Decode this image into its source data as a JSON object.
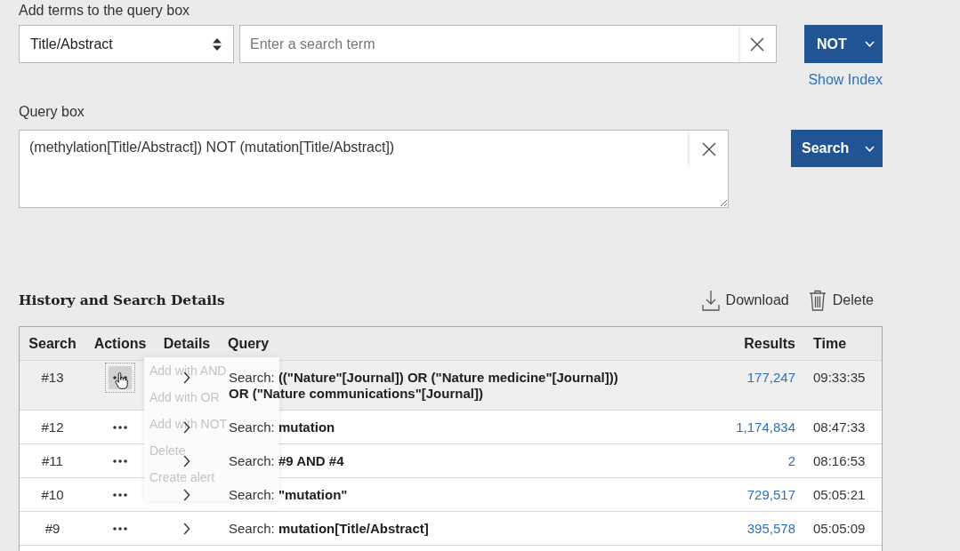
{
  "query_builder": {
    "label": "Add terms to the query box",
    "field": {
      "value": "Title/Abstract"
    },
    "term_input": {
      "placeholder": "Enter a search term"
    },
    "operator_button": "NOT",
    "show_index": "Show Index",
    "query_box": {
      "label": "Query box",
      "value": "(methylation[Title/Abstract]) NOT (mutation[Title/Abstract])"
    },
    "search_button": "Search"
  },
  "history": {
    "title": "History and Search Details",
    "download": "Download",
    "delete": "Delete",
    "columns": [
      "Search",
      "Actions",
      "Details",
      "Query",
      "Results",
      "Time"
    ],
    "rows": [
      {
        "search": "#13",
        "query": "Search: **((\"Nature\"[Journal]) OR (\"Nature medicine\"[Journal])) OR (\"Nature communications\"[Journal])**",
        "results": "177,247",
        "time": "09:33:35",
        "highlighted": true,
        "menu_open": true
      },
      {
        "search": "#12",
        "query": "Search: **mutation**",
        "results": "1,174,834",
        "time": "08:47:33",
        "highlighted": false,
        "menu_open": false
      },
      {
        "search": "#11",
        "query": "Search: **#9 AND #4**",
        "results": "2",
        "time": "08:16:53",
        "highlighted": false,
        "menu_open": false
      },
      {
        "search": "#10",
        "query": "Search: **\"mutation\"**",
        "results": "729,517",
        "time": "05:05:21",
        "highlighted": false,
        "menu_open": false
      },
      {
        "search": "#9",
        "query": "Search: **mutation[Title/Abstract]**",
        "results": "395,578",
        "time": "05:05:09",
        "highlighted": false,
        "menu_open": false
      }
    ],
    "actions_menu": [
      "Add with AND",
      "Add with OR",
      "Add with NOT",
      "Delete",
      "Create alert"
    ]
  }
}
